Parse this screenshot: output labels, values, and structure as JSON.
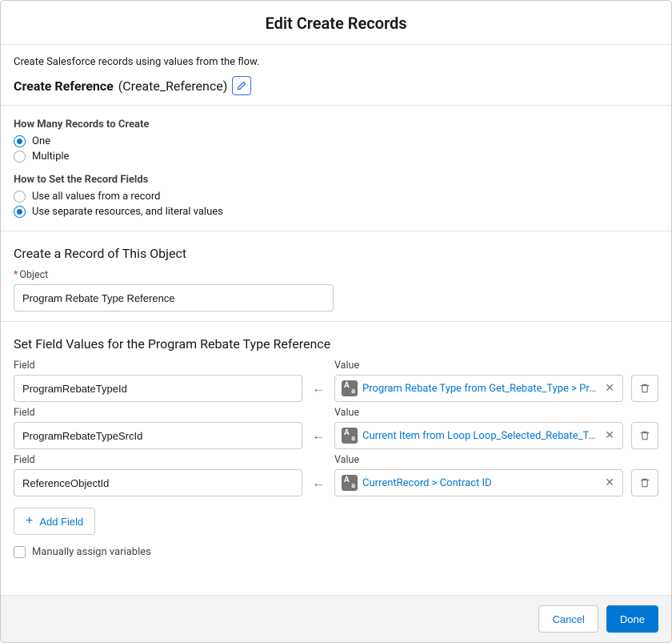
{
  "header": {
    "title": "Edit Create Records"
  },
  "intro": {
    "description": "Create Salesforce records using values from the flow."
  },
  "name": {
    "label": "Create Reference",
    "api": "(Create_Reference)"
  },
  "howMany": {
    "legend": "How Many Records to Create",
    "options": [
      {
        "label": "One",
        "checked": true
      },
      {
        "label": "Multiple",
        "checked": false
      }
    ]
  },
  "howSet": {
    "legend": "How to Set the Record Fields",
    "options": [
      {
        "label": "Use all values from a record",
        "checked": false
      },
      {
        "label": "Use separate resources, and literal values",
        "checked": true
      }
    ]
  },
  "objectSection": {
    "title": "Create a Record of This Object",
    "fieldLabel": "Object",
    "value": "Program Rebate Type Reference"
  },
  "mapSection": {
    "title": "Set Field Values for the Program Rebate Type Reference",
    "fieldHeader": "Field",
    "valueHeader": "Value",
    "rows": [
      {
        "field": "ProgramRebateTypeId",
        "value": "Program Rebate Type from Get_Rebate_Type > Pro..."
      },
      {
        "field": "ProgramRebateTypeSrcId",
        "value": "Current Item from Loop Loop_Selected_Rebate_Ty..."
      },
      {
        "field": "ReferenceObjectId",
        "value": "CurrentRecord > Contract ID"
      }
    ],
    "addLabel": "Add Field"
  },
  "manual": {
    "label": "Manually assign variables"
  },
  "footer": {
    "cancel": "Cancel",
    "done": "Done"
  }
}
